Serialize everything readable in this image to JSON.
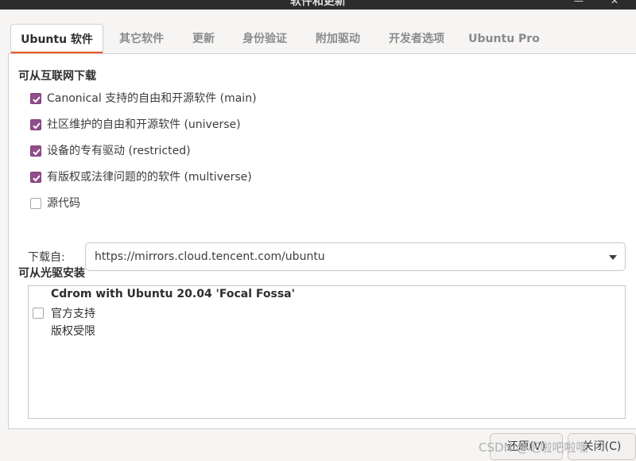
{
  "window": {
    "title": "软件和更新"
  },
  "tabs": [
    {
      "label": "Ubuntu 软件",
      "active": true
    },
    {
      "label": "其它软件",
      "active": false
    },
    {
      "label": "更新",
      "active": false
    },
    {
      "label": "身份验证",
      "active": false
    },
    {
      "label": "附加驱动",
      "active": false
    },
    {
      "label": "开发者选项",
      "active": false
    },
    {
      "label": "Ubuntu Pro",
      "active": false
    }
  ],
  "internet": {
    "heading": "可从互联网下载",
    "sources": [
      {
        "label": "Canonical 支持的自由和开源软件 (main)",
        "checked": true
      },
      {
        "label": "社区维护的自由和开源软件 (universe)",
        "checked": true
      },
      {
        "label": "设备的专有驱动 (restricted)",
        "checked": true
      },
      {
        "label": "有版权或法律问题的的软件 (multiverse)",
        "checked": true
      },
      {
        "label": "源代码",
        "checked": false
      }
    ],
    "download_from_label": "下载自:",
    "download_from_value": "https://mirrors.cloud.tencent.com/ubuntu"
  },
  "cdrom": {
    "heading": "可从光驱安装",
    "items": [
      {
        "title": "Cdrom with Ubuntu 20.04 'Focal Fossa'",
        "line2": "官方支持",
        "line3": "版权受限",
        "checked": false
      }
    ]
  },
  "buttons": {
    "revert": "还原(V)",
    "close": "关闭(C)"
  },
  "watermark": "CSDN @吧啦吧啦嘿",
  "colors": {
    "accent": "#e95420",
    "checkbox": "#924d8b"
  }
}
